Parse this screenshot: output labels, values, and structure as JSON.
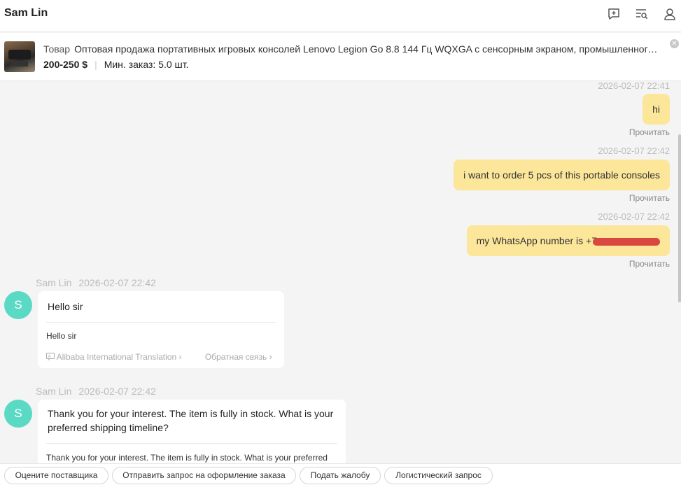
{
  "header": {
    "title": "Sam Lin",
    "icons": [
      "add-chat-icon",
      "search-list-icon",
      "user-profile-icon"
    ]
  },
  "product": {
    "label": "Товар",
    "name": "Оптовая продажа портативных игровых консолей Lenovo Legion Go 8.8 144 Гц WQXGA с сенсорным экраном, промышленного качества",
    "price": "200-250 $",
    "min_order": "Мин. заказ: 5.0 шт."
  },
  "messages_me": [
    {
      "time": "2026-02-07 22:41",
      "text": "hi",
      "status": "Прочитать"
    },
    {
      "time": "2026-02-07 22:42",
      "text": "i want to order 5 pcs of this portable consoles",
      "status": "Прочитать"
    },
    {
      "time": "2026-02-07 22:42",
      "text": "my WhatsApp number is +7",
      "status": "Прочитать"
    }
  ],
  "messages_them": [
    {
      "avatar": "S",
      "sender": "Sam Lin",
      "time": "2026-02-07 22:42",
      "text": "Hello sir",
      "translation": "Hello sir",
      "translator": "Alibaba International Translation",
      "feedback": "Обратная связь"
    },
    {
      "avatar": "S",
      "sender": "Sam Lin",
      "time": "2026-02-07 22:42",
      "text": "Thank you for your interest. The item is fully in stock. What is your preferred shipping timeline?",
      "translation": "Thank you for your interest. The item is fully in stock. What is your preferred shipping timeline?"
    }
  ],
  "quick_actions": [
    "Оцените поставщика",
    "Отправить запрос на оформление заказа",
    "Подать жалобу",
    "Логистический запрос"
  ],
  "colors": {
    "my_bubble": "#fbe69a",
    "avatar": "#5ad9c4",
    "redaction": "#d9473e"
  }
}
